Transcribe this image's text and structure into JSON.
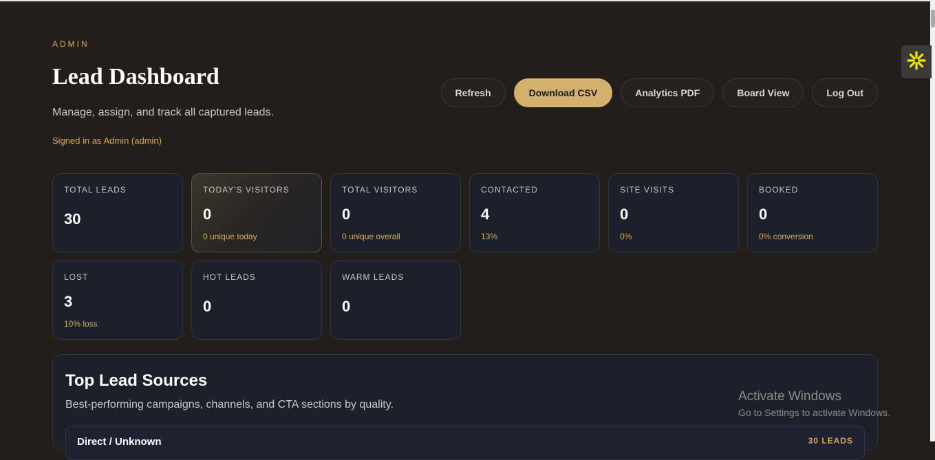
{
  "header": {
    "eyebrow": "ADMIN",
    "title": "Lead Dashboard",
    "subtitle": "Manage, assign, and track all captured leads.",
    "signed_in": "Signed in as Admin (admin)"
  },
  "actions": {
    "refresh": "Refresh",
    "download_csv": "Download CSV",
    "analytics_pdf": "Analytics PDF",
    "board_view": "Board View",
    "log_out": "Log Out"
  },
  "stats": {
    "total_leads": {
      "label": "TOTAL LEADS",
      "value": "30"
    },
    "todays_visitors": {
      "label": "TODAY'S VISITORS",
      "value": "0",
      "note": "0 unique today"
    },
    "total_visitors": {
      "label": "TOTAL VISITORS",
      "value": "0",
      "note": "0 unique overall"
    },
    "contacted": {
      "label": "CONTACTED",
      "value": "4",
      "note": "13%"
    },
    "site_visits": {
      "label": "SITE VISITS",
      "value": "0",
      "note": "0%"
    },
    "booked": {
      "label": "BOOKED",
      "value": "0",
      "note": "0% conversion"
    },
    "lost": {
      "label": "LOST",
      "value": "3",
      "note": "10% loss"
    },
    "hot_leads": {
      "label": "HOT LEADS",
      "value": "0"
    },
    "warm_leads": {
      "label": "WARM LEADS",
      "value": "0"
    }
  },
  "sources": {
    "title": "Top Lead Sources",
    "subtitle": "Best-performing campaigns, channels, and CTA sections by quality.",
    "rows": [
      {
        "name": "Direct / Unknown",
        "count": "30 LEADS"
      }
    ]
  },
  "overlay": {
    "activate_title": "Activate Windows",
    "activate_sub": "Go to Settings to activate Windows."
  },
  "colors": {
    "accent": "#d4b06e",
    "background": "#221f1b",
    "card": "#1c202b"
  },
  "icons": {
    "side_widget": "asterisk-burst-icon"
  }
}
